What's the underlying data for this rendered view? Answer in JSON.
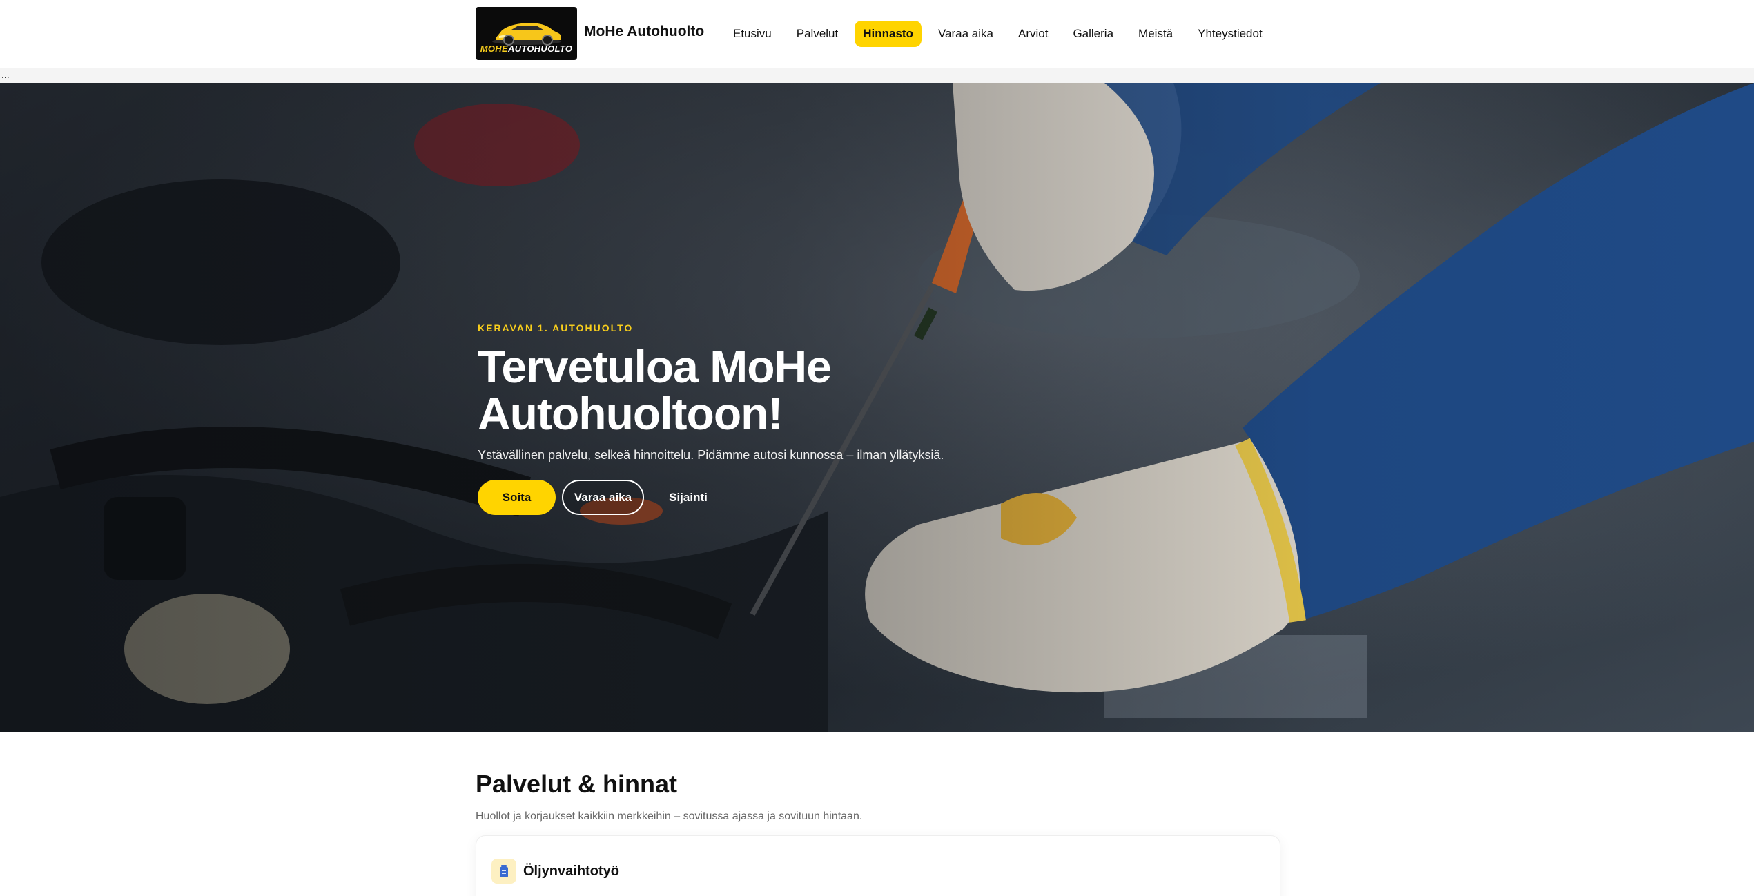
{
  "header": {
    "logo": {
      "word_yellow": "MOHE",
      "word_white": "AUTOHUOLTO"
    },
    "brand_name": "MoHe Autohuolto",
    "nav": [
      {
        "label": "Etusivu",
        "active": false
      },
      {
        "label": "Palvelut",
        "active": false
      },
      {
        "label": "Hinnasto",
        "active": true
      },
      {
        "label": "Varaa aika",
        "active": false
      },
      {
        "label": "Arviot",
        "active": false
      },
      {
        "label": "Galleria",
        "active": false
      },
      {
        "label": "Meistä",
        "active": false
      },
      {
        "label": "Yhteystiedot",
        "active": false
      }
    ]
  },
  "band": {
    "text": "..."
  },
  "hero": {
    "eyebrow": "KERAVAN 1. AUTOHUOLTO",
    "title_line1": "Tervetuloa MoHe",
    "title_line2": "Autohuoltoon!",
    "subtitle": "Ystävällinen palvelu, selkeä hinnoittelu. Pidämme autosi kunnossa – ilman yllätyksiä.",
    "buttons": {
      "call": "Soita",
      "book": "Varaa aika",
      "location": "Sijainti"
    }
  },
  "services": {
    "title": "Palvelut & hinnat",
    "subtitle": "Huollot ja korjaukset kaikkiin merkkeihin – sovitussa ajassa ja sovituun hintaan.",
    "cards": [
      {
        "icon": "oil-can-icon",
        "title": "Öljynvaihtotyö"
      }
    ]
  },
  "colors": {
    "accent": "#ffd400",
    "text": "#111111",
    "muted": "#666666"
  }
}
